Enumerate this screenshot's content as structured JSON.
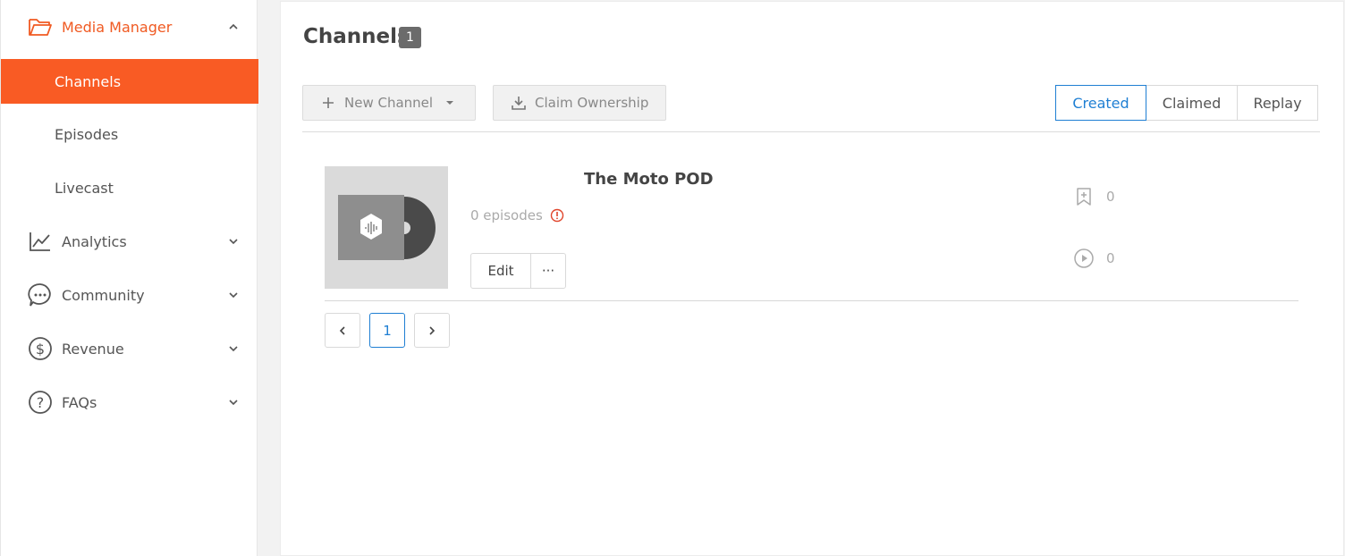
{
  "sidebar": {
    "media_manager": {
      "label": "Media Manager",
      "icon": "folder-open-icon"
    },
    "sub_items": [
      {
        "label": "Channels",
        "active": true
      },
      {
        "label": "Episodes",
        "active": false
      },
      {
        "label": "Livecast",
        "active": false
      }
    ],
    "groups": [
      {
        "label": "Analytics",
        "icon": "analytics-chart-icon"
      },
      {
        "label": "Community",
        "icon": "chat-bubble-icon"
      },
      {
        "label": "Revenue",
        "icon": "dollar-circle-icon"
      },
      {
        "label": "FAQs",
        "icon": "question-circle-icon"
      }
    ]
  },
  "main": {
    "title": "Channels",
    "count": "1",
    "new_channel_label": "New Channel",
    "claim_ownership_label": "Claim Ownership",
    "tabs": [
      {
        "label": "Created",
        "active": true
      },
      {
        "label": "Claimed",
        "active": false
      },
      {
        "label": "Replay",
        "active": false
      }
    ],
    "channels": [
      {
        "name": "The Moto POD",
        "episodes": "0 episodes",
        "edit_label": "Edit",
        "more_label": "···",
        "subscribers": "0",
        "plays": "0"
      }
    ],
    "pagination": {
      "prev": "<",
      "current": "1",
      "next": ">"
    }
  },
  "colors": {
    "accent": "#f95b24",
    "link_blue": "#1f7fd3",
    "warning": "#e0452b"
  }
}
